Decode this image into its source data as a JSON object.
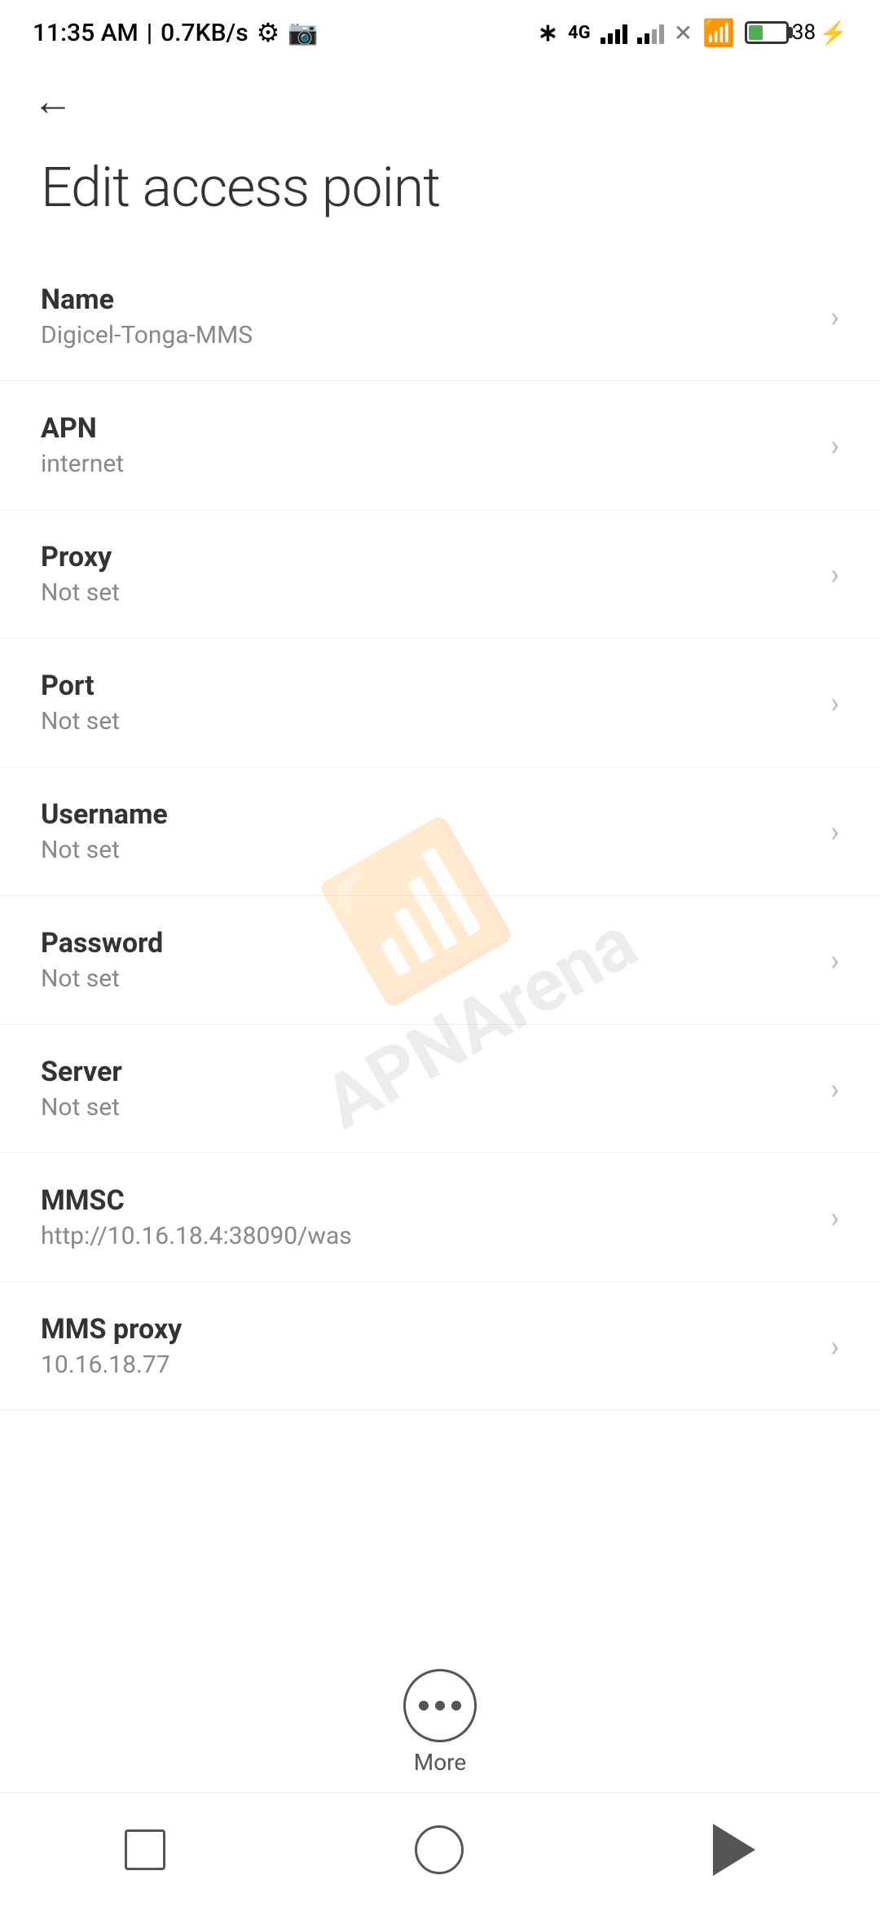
{
  "statusBar": {
    "time": "11:35 AM",
    "speed": "0.7KB/s"
  },
  "header": {
    "backLabel": "←",
    "title": "Edit access point"
  },
  "settings": {
    "items": [
      {
        "label": "Name",
        "value": "Digicel-Tonga-MMS"
      },
      {
        "label": "APN",
        "value": "internet"
      },
      {
        "label": "Proxy",
        "value": "Not set"
      },
      {
        "label": "Port",
        "value": "Not set"
      },
      {
        "label": "Username",
        "value": "Not set"
      },
      {
        "label": "Password",
        "value": "Not set"
      },
      {
        "label": "Server",
        "value": "Not set"
      },
      {
        "label": "MMSC",
        "value": "http://10.16.18.4:38090/was"
      },
      {
        "label": "MMS proxy",
        "value": "10.16.18.77"
      }
    ]
  },
  "bottomMore": {
    "label": "More"
  },
  "watermark": "APNArena"
}
